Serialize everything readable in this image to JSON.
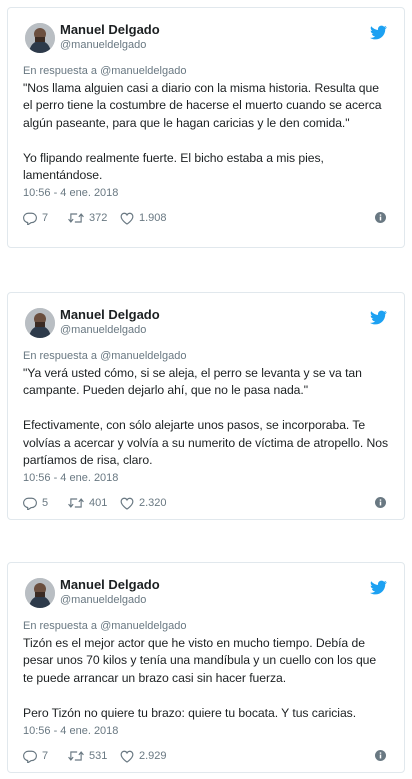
{
  "colors": {
    "border": "#e1e8ed",
    "twitter_blue": "#1da1f2",
    "secondary_text": "#697882",
    "primary_text": "#1c2022"
  },
  "icons": {
    "brand": "twitter-bird-icon",
    "reply": "reply-icon",
    "retweet": "retweet-icon",
    "like": "heart-icon",
    "info": "info-icon"
  },
  "tweets": [
    {
      "author": {
        "name": "Manuel Delgado",
        "handle": "@manueldelgado"
      },
      "reply_prefix": "En respuesta a ",
      "reply_handle": "@manueldelgado",
      "text": "\"Nos llama alguien casi a diario con la misma historia. Resulta que el perro tiene la costumbre de hacerse el muerto cuando se acerca algún paseante, para que le hagan caricias y le den comida.\"\n\nYo flipando realmente fuerte. El bicho estaba a mis pies, lamentándose.",
      "timestamp": "10:56 - 4 ene. 2018",
      "replies": "7",
      "retweets": "372",
      "likes": "1.908"
    },
    {
      "author": {
        "name": "Manuel Delgado",
        "handle": "@manueldelgado"
      },
      "reply_prefix": "En respuesta a ",
      "reply_handle": "@manueldelgado",
      "text": "\"Ya verá usted cómo, si se aleja, el perro se levanta y se va tan campante. Pueden dejarlo ahí, que no le pasa nada.\"\n\nEfectivamente, con sólo alejarte unos pasos, se incorporaba. Te volvías a acercar y volvía a su numerito de víctima de atropello. Nos partíamos de risa, claro.",
      "timestamp": "10:56 - 4 ene. 2018",
      "replies": "5",
      "retweets": "401",
      "likes": "2.320"
    },
    {
      "author": {
        "name": "Manuel Delgado",
        "handle": "@manueldelgado"
      },
      "reply_prefix": "En respuesta a ",
      "reply_handle": "@manueldelgado",
      "text": "Tizón es el mejor actor que he visto en mucho tiempo. Debía de pesar unos 70 kilos y tenía una mandíbula y un cuello con los que te puede arrancar un brazo casi sin hacer fuerza.\n\nPero Tizón no quiere tu brazo: quiere tu bocata. Y tus caricias.",
      "timestamp": "10:56 - 4 ene. 2018",
      "replies": "7",
      "retweets": "531",
      "likes": "2.929"
    }
  ]
}
